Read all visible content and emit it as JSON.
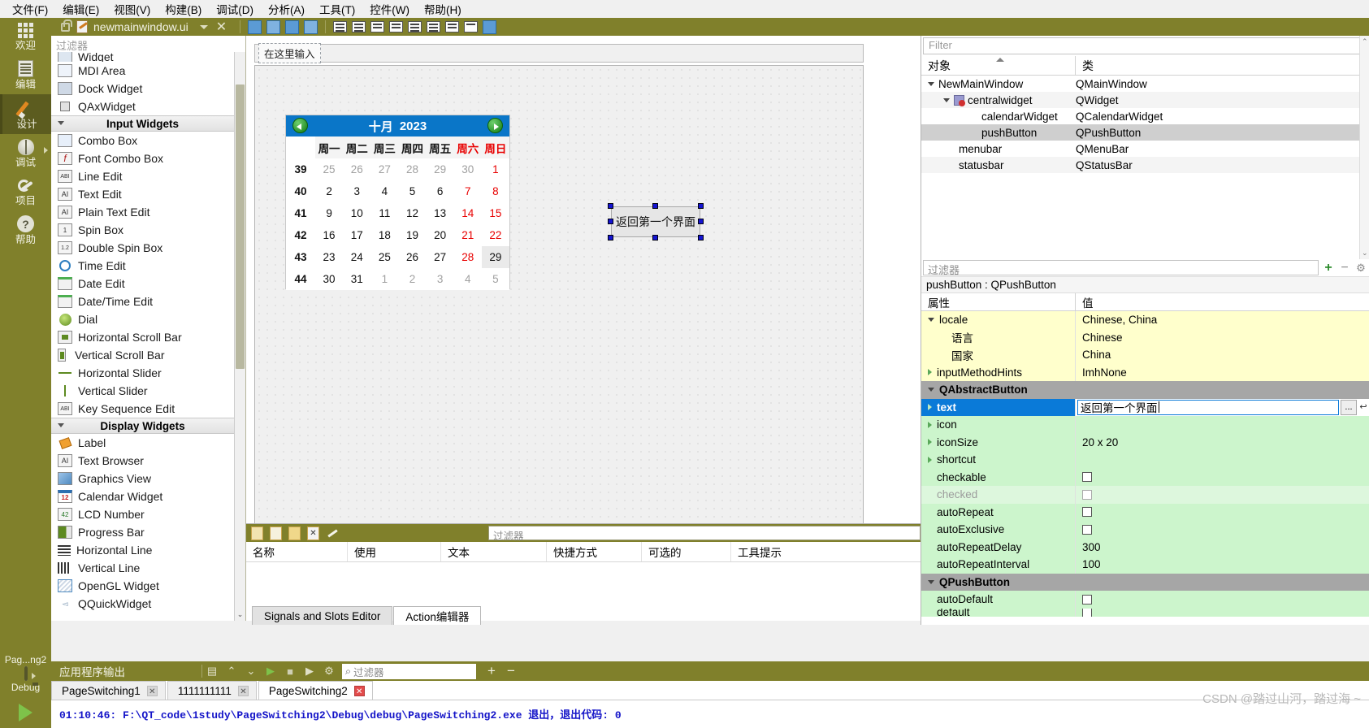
{
  "menubar": {
    "items": [
      "文件(F)",
      "编辑(E)",
      "视图(V)",
      "构建(B)",
      "调试(D)",
      "分析(A)",
      "工具(T)",
      "控件(W)",
      "帮助(H)"
    ]
  },
  "modebar": {
    "items": [
      {
        "label": "欢迎",
        "icon": "grid-icon"
      },
      {
        "label": "编辑",
        "icon": "document-icon"
      },
      {
        "label": "设计",
        "icon": "pencil-icon"
      },
      {
        "label": "调试",
        "icon": "bug-icon"
      },
      {
        "label": "项目",
        "icon": "wrench-icon"
      },
      {
        "label": "帮助",
        "icon": "question-icon"
      }
    ],
    "kit_name": "Pag...ng2",
    "build_config": "Debug"
  },
  "editor_tabbar": {
    "filename": "newmainwindow.ui",
    "close_label": "✕"
  },
  "widgetbox": {
    "filter_placeholder": "过滤器",
    "rows": [
      {
        "label": "Widget",
        "type": "item",
        "icon": "widget-icon",
        "clipped": true
      },
      {
        "label": "MDI Area",
        "type": "item",
        "icon": "mdi-area-icon"
      },
      {
        "label": "Dock Widget",
        "type": "item",
        "icon": "dock-widget-icon"
      },
      {
        "label": "QAxWidget",
        "type": "item",
        "icon": "qaxwidget-icon"
      },
      {
        "label": "Input Widgets",
        "type": "group"
      },
      {
        "label": "Combo Box",
        "type": "item",
        "icon": "combo-box-icon"
      },
      {
        "label": "Font Combo Box",
        "type": "item",
        "icon": "font-combo-box-icon"
      },
      {
        "label": "Line Edit",
        "type": "item",
        "icon": "line-edit-icon"
      },
      {
        "label": "Text Edit",
        "type": "item",
        "icon": "text-edit-icon"
      },
      {
        "label": "Plain Text Edit",
        "type": "item",
        "icon": "plain-text-edit-icon"
      },
      {
        "label": "Spin Box",
        "type": "item",
        "icon": "spin-box-icon"
      },
      {
        "label": "Double Spin Box",
        "type": "item",
        "icon": "double-spin-box-icon"
      },
      {
        "label": "Time Edit",
        "type": "item",
        "icon": "time-edit-icon"
      },
      {
        "label": "Date Edit",
        "type": "item",
        "icon": "date-edit-icon"
      },
      {
        "label": "Date/Time Edit",
        "type": "item",
        "icon": "date-time-edit-icon"
      },
      {
        "label": "Dial",
        "type": "item",
        "icon": "dial-icon"
      },
      {
        "label": "Horizontal Scroll Bar",
        "type": "item",
        "icon": "h-scrollbar-icon"
      },
      {
        "label": "Vertical Scroll Bar",
        "type": "item",
        "icon": "v-scrollbar-icon"
      },
      {
        "label": "Horizontal Slider",
        "type": "item",
        "icon": "h-slider-icon"
      },
      {
        "label": "Vertical Slider",
        "type": "item",
        "icon": "v-slider-icon"
      },
      {
        "label": "Key Sequence Edit",
        "type": "item",
        "icon": "key-sequence-edit-icon"
      },
      {
        "label": "Display Widgets",
        "type": "group"
      },
      {
        "label": "Label",
        "type": "item",
        "icon": "label-icon"
      },
      {
        "label": "Text Browser",
        "type": "item",
        "icon": "text-browser-icon"
      },
      {
        "label": "Graphics View",
        "type": "item",
        "icon": "graphics-view-icon"
      },
      {
        "label": "Calendar Widget",
        "type": "item",
        "icon": "calendar-widget-icon"
      },
      {
        "label": "LCD Number",
        "type": "item",
        "icon": "lcd-number-icon"
      },
      {
        "label": "Progress Bar",
        "type": "item",
        "icon": "progress-bar-icon"
      },
      {
        "label": "Horizontal Line",
        "type": "item",
        "icon": "h-line-icon"
      },
      {
        "label": "Vertical Line",
        "type": "item",
        "icon": "v-line-icon"
      },
      {
        "label": "OpenGL Widget",
        "type": "item",
        "icon": "opengl-widget-icon"
      },
      {
        "label": "QQuickWidget",
        "type": "item",
        "icon": "qquickwidget-icon"
      }
    ]
  },
  "form": {
    "menubar_placeholder": "在这里输入",
    "calendar": {
      "month": "十月",
      "year": "2023",
      "weekday_headers": [
        "周一",
        "周二",
        "周三",
        "周四",
        "周五",
        "周六",
        "周日"
      ],
      "weekend_headers": [
        "周六",
        "周日"
      ],
      "weeks": [
        {
          "num": "39",
          "days": [
            "25",
            "26",
            "27",
            "28",
            "29",
            "30",
            "1"
          ],
          "out": [
            true,
            true,
            true,
            true,
            true,
            true,
            true
          ]
        },
        {
          "num": "40",
          "days": [
            "2",
            "3",
            "4",
            "5",
            "6",
            "7",
            "8"
          ],
          "out": [
            false,
            false,
            false,
            false,
            false,
            false,
            false
          ]
        },
        {
          "num": "41",
          "days": [
            "9",
            "10",
            "11",
            "12",
            "13",
            "14",
            "15"
          ],
          "out": [
            false,
            false,
            false,
            false,
            false,
            false,
            false
          ]
        },
        {
          "num": "42",
          "days": [
            "16",
            "17",
            "18",
            "19",
            "20",
            "21",
            "22"
          ],
          "out": [
            false,
            false,
            false,
            false,
            false,
            false,
            false
          ]
        },
        {
          "num": "43",
          "days": [
            "23",
            "24",
            "25",
            "26",
            "27",
            "28",
            "29"
          ],
          "out": [
            false,
            false,
            false,
            false,
            false,
            false,
            false
          ]
        },
        {
          "num": "44",
          "days": [
            "30",
            "31",
            "1",
            "2",
            "3",
            "4",
            "5"
          ],
          "out": [
            false,
            false,
            true,
            true,
            true,
            true,
            true
          ]
        }
      ],
      "selected_day": "29",
      "prev_icon": "prev-month-arrow-icon",
      "next_icon": "next-month-arrow-icon"
    },
    "push_button": {
      "text": "返回第一个界面"
    }
  },
  "action_editor": {
    "filter_placeholder": "过滤器",
    "columns": [
      "名称",
      "使用",
      "文本",
      "快捷方式",
      "可选的",
      "工具提示"
    ],
    "toolbar_icons": [
      "new-action-icon",
      "copy-action-icon",
      "edit-action-icon",
      "delete-action-icon",
      "configure-icon"
    ]
  },
  "bottom_editor_tabs": [
    {
      "label": "Signals and Slots Editor",
      "active": false
    },
    {
      "label": "Action编辑器",
      "active": true
    }
  ],
  "object_inspector": {
    "filter_placeholder": "Filter",
    "columns": [
      "对象",
      "类"
    ],
    "rows": [
      {
        "object": "NewMainWindow",
        "class": "QMainWindow",
        "depth": 0,
        "expandable": true,
        "selected": false
      },
      {
        "object": "centralwidget",
        "class": "QWidget",
        "depth": 1,
        "expandable": true,
        "selected": false,
        "icon": "central-widget-icon"
      },
      {
        "object": "calendarWidget",
        "class": "QCalendarWidget",
        "depth": 2,
        "expandable": false,
        "selected": false
      },
      {
        "object": "pushButton",
        "class": "QPushButton",
        "depth": 2,
        "expandable": false,
        "selected": true
      },
      {
        "object": "menubar",
        "class": "QMenuBar",
        "depth": 1,
        "expandable": false,
        "selected": false
      },
      {
        "object": "statusbar",
        "class": "QStatusBar",
        "depth": 1,
        "expandable": false,
        "selected": false
      }
    ]
  },
  "property_editor": {
    "filter_placeholder": "过滤器",
    "object_header": "pushButton : QPushButton",
    "columns": [
      "属性",
      "值"
    ],
    "add_label": "+",
    "remove_label": "−",
    "rows": [
      {
        "name": "locale",
        "value": "Chinese, China",
        "style": "yellow",
        "arrow": "down",
        "indent": 0
      },
      {
        "name": "语言",
        "value": "Chinese",
        "style": "yellow",
        "arrow": "none",
        "indent": 1
      },
      {
        "name": "国家",
        "value": "China",
        "style": "yellow",
        "arrow": "none",
        "indent": 1
      },
      {
        "name": "inputMethodHints",
        "value": "ImhNone",
        "style": "yellow",
        "arrow": "right",
        "indent": 0
      },
      {
        "name": "QAbstractButton",
        "value": "",
        "style": "group",
        "arrow": "down",
        "indent": 0
      },
      {
        "name": "text",
        "value": "返回第一个界面",
        "style": "selected",
        "arrow": "right",
        "indent": 0,
        "editing": true
      },
      {
        "name": "icon",
        "value": "",
        "style": "green",
        "arrow": "right",
        "indent": 0
      },
      {
        "name": "iconSize",
        "value": "20 x 20",
        "style": "green",
        "arrow": "right",
        "indent": 0
      },
      {
        "name": "shortcut",
        "value": "",
        "style": "green",
        "arrow": "right",
        "indent": 0
      },
      {
        "name": "checkable",
        "value": "",
        "style": "green",
        "arrow": "none",
        "indent": 0,
        "checkbox": true
      },
      {
        "name": "checked",
        "value": "",
        "style": "green2",
        "arrow": "none",
        "indent": 0,
        "checkbox": true,
        "disabled": true
      },
      {
        "name": "autoRepeat",
        "value": "",
        "style": "green",
        "arrow": "none",
        "indent": 0,
        "checkbox": true
      },
      {
        "name": "autoExclusive",
        "value": "",
        "style": "green",
        "arrow": "none",
        "indent": 0,
        "checkbox": true
      },
      {
        "name": "autoRepeatDelay",
        "value": "300",
        "style": "green",
        "arrow": "none",
        "indent": 0
      },
      {
        "name": "autoRepeatInterval",
        "value": "100",
        "style": "green",
        "arrow": "none",
        "indent": 0
      },
      {
        "name": "QPushButton",
        "value": "",
        "style": "group",
        "arrow": "down",
        "indent": 0
      },
      {
        "name": "autoDefault",
        "value": "",
        "style": "green",
        "arrow": "none",
        "indent": 0,
        "checkbox": true
      },
      {
        "name": "default",
        "value": "",
        "style": "green",
        "arrow": "none",
        "indent": 0,
        "checkbox": true,
        "clipped": true
      }
    ]
  },
  "application_output": {
    "title": "应用程序输出",
    "filter_placeholder": "过滤器",
    "tabs": [
      {
        "label": "PageSwitching1",
        "active": false
      },
      {
        "label": "1111111111",
        "active": false
      },
      {
        "label": "PageSwitching2",
        "active": true
      }
    ],
    "console_line": "01:10:46: F:\\QT_code\\1study\\PageSwitching2\\Debug\\debug\\PageSwitching2.exe 退出，退出代码: 0"
  },
  "watermark": "CSDN @踏过山河，踏过海 ~",
  "colors": {
    "olive": "#80802b",
    "accent_blue": "#0a7ad8",
    "calendar_header": "#0a76c8",
    "weekend_red": "#e80000",
    "property_yellow": "#ffffcc",
    "property_green": "#ccf5cc",
    "console_text": "#1414c8"
  }
}
